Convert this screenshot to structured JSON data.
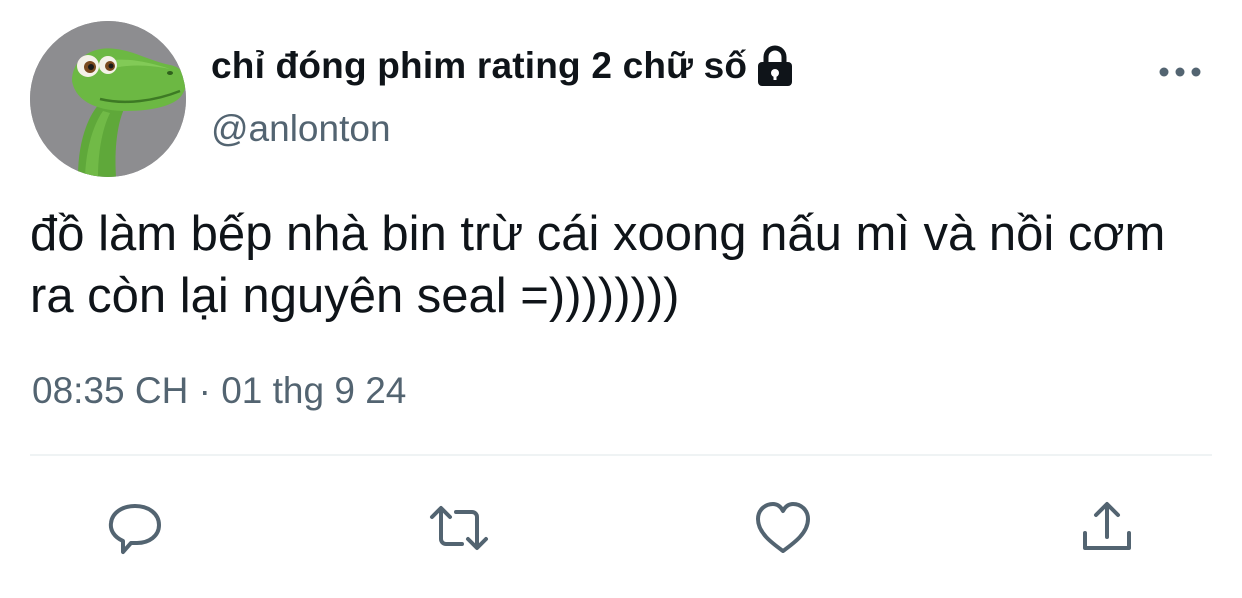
{
  "tweet": {
    "display_name": "chỉ đóng phim rating 2 chữ số",
    "handle": "@anlonton",
    "text": "đồ làm bếp nhà bin trừ cái xoong nấu mì và nồi cơm ra còn lại nguyên seal =))))))))",
    "time": "08:35 CH",
    "separator": "·",
    "date": "01 thg 9 24",
    "protected_icon": "lock-icon"
  },
  "icons": {
    "more": "more-horizontal-icon",
    "reply": "reply-icon",
    "retweet": "retweet-icon",
    "like": "heart-icon",
    "share": "share-icon"
  },
  "colors": {
    "text": "#0f1419",
    "secondary_text": "#536471",
    "icon": "#536471",
    "divider": "#eff3f4",
    "background": "#ffffff"
  }
}
